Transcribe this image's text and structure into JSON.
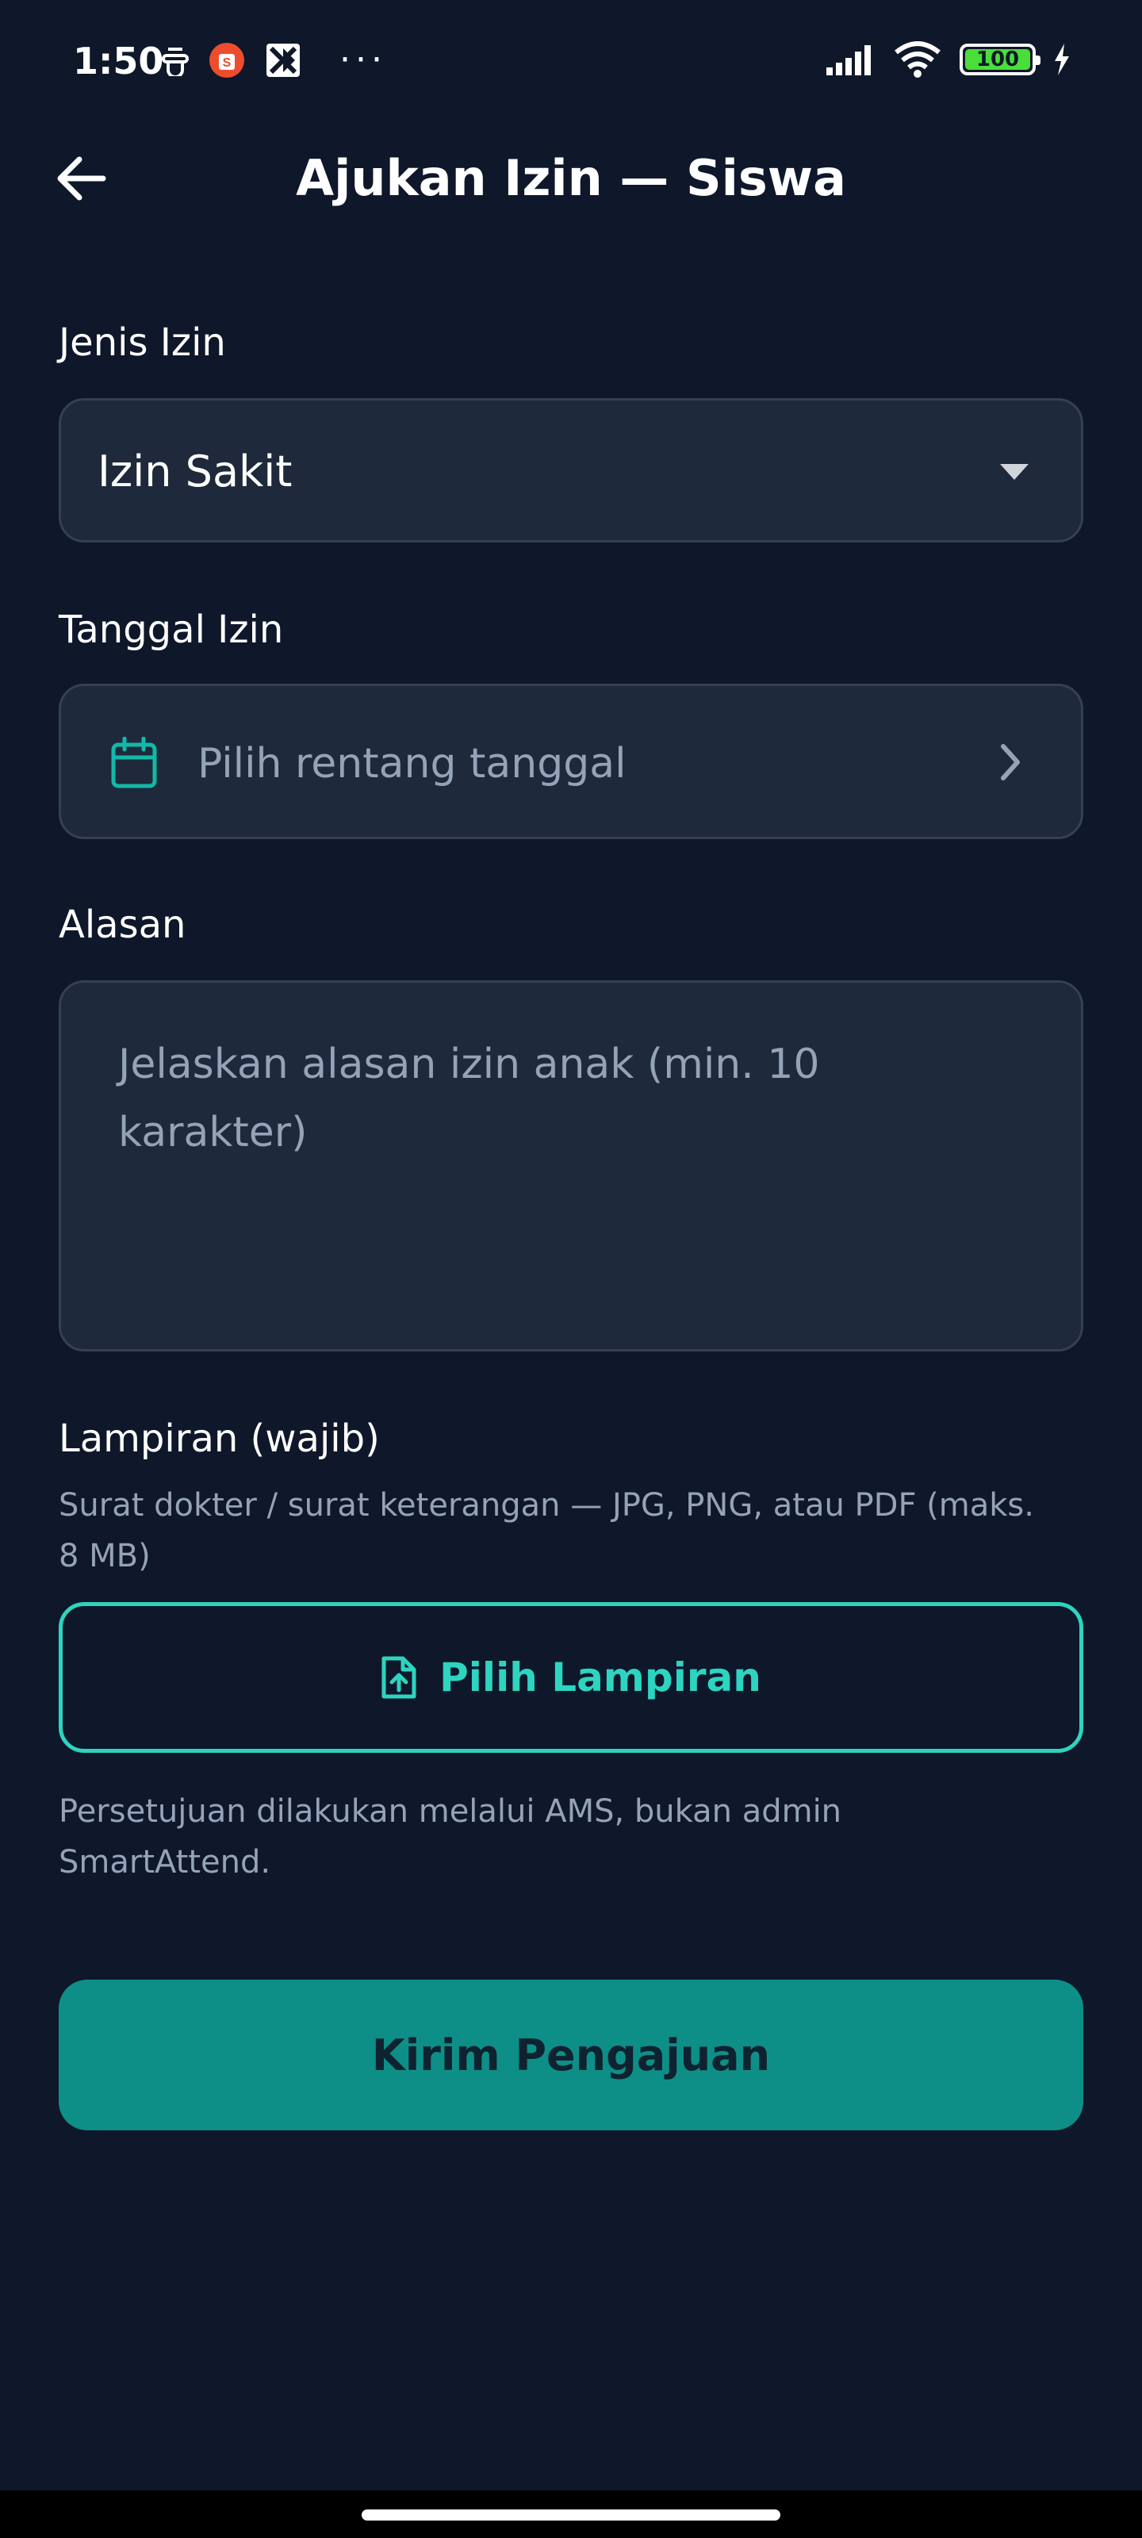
{
  "status_bar": {
    "time": "1:50",
    "battery": "100",
    "icons": [
      "notification-icon",
      "shopee-icon",
      "kite-app-icon",
      "more-dots-icon",
      "signal-icon",
      "wifi-icon",
      "battery-icon",
      "charging-icon"
    ],
    "more": "···"
  },
  "app_bar": {
    "title": "Ajukan Izin — Siswa",
    "back_icon": "arrow-left-icon"
  },
  "form": {
    "type_label": "Jenis Izin",
    "type_value": "Izin Sakit",
    "date_label": "Tanggal Izin",
    "date_placeholder": "Pilih rentang tanggal",
    "reason_label": "Alasan",
    "reason_placeholder": "Jelaskan alasan izin anak (min. 10 karakter)",
    "attachment_label": "Lampiran (wajib)",
    "attachment_hint": "Surat dokter / surat keterangan — JPG, PNG, atau PDF (maks. 8 MB)",
    "attachment_button": "Pilih Lampiran",
    "approval_note": "Persetujuan dilakukan melalui AMS, bukan admin SmartAttend.",
    "submit_button": "Kirim Pengajuan"
  },
  "colors": {
    "background": "#0f172a",
    "field_bg": "#1e293b",
    "accent": "#2dd4bf",
    "submit_bg": "#0d8f87"
  }
}
